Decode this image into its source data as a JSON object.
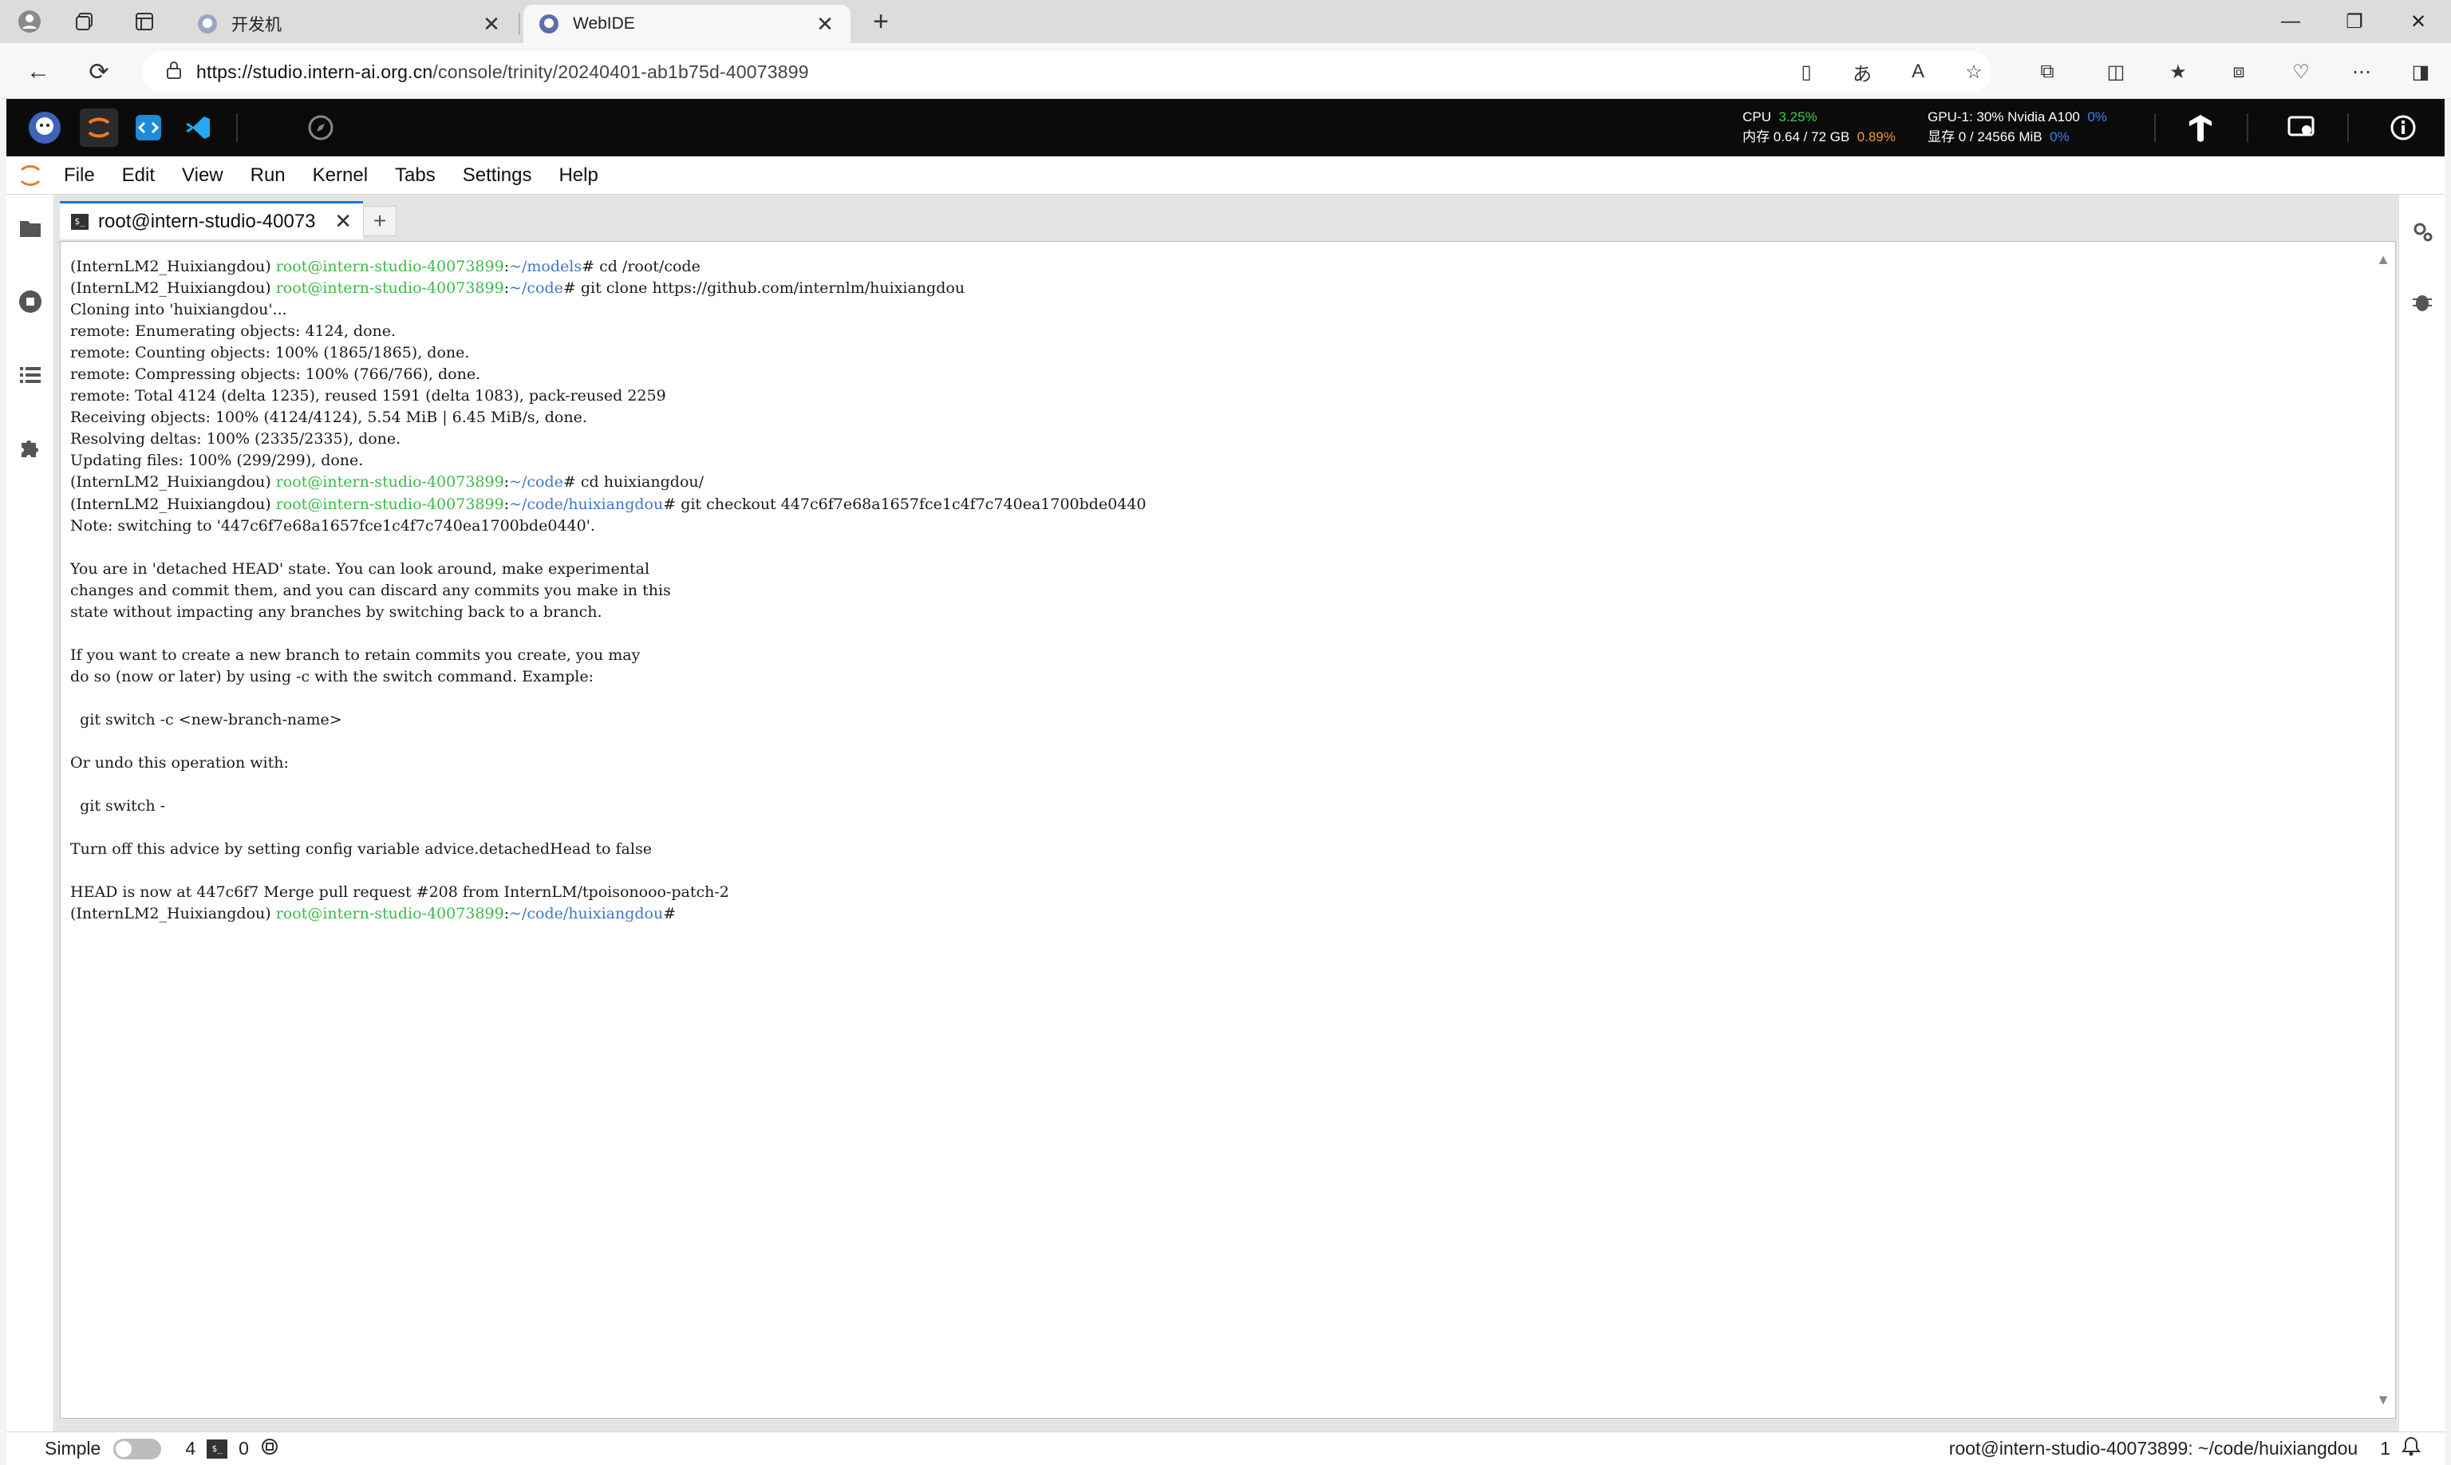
{
  "browser": {
    "tabs": [
      {
        "title": "开发机",
        "active": false
      },
      {
        "title": "WebIDE",
        "active": true
      }
    ],
    "url_host": "https://studio.intern-ai.org.cn",
    "url_path": "/console/trinity/20240401-ab1b75d-40073899"
  },
  "ide": {
    "stats": {
      "cpu_label": "CPU",
      "cpu_value": "3.25%",
      "mem_label": "内存",
      "mem_value": "0.64 / 72 GB",
      "mem_percent": "0.89%",
      "gpu_label": "GPU-1: 30% Nvidia A100",
      "gpu_percent": "0%",
      "vram_label": "显存",
      "vram_value": "0 / 24566 MiB",
      "vram_percent": "0%"
    },
    "menu": [
      "File",
      "Edit",
      "View",
      "Run",
      "Kernel",
      "Tabs",
      "Settings",
      "Help"
    ],
    "doc_tab_title": "root@intern-studio-40073",
    "term_icon_text": "$_"
  },
  "terminal": {
    "env": "(InternLM2_Huixiangdou)",
    "user_host": "root@intern-studio-40073899",
    "prompts": [
      {
        "path": "~/models",
        "cmd": "cd /root/code"
      },
      {
        "path": "~/code",
        "cmd": "git clone https://github.com/internlm/huixiangdou"
      },
      {
        "path": "~/code",
        "cmd": "cd huixiangdou/"
      },
      {
        "path": "~/code/huixiangdou",
        "cmd": "git checkout 447c6f7e68a1657fce1c4f7c740ea1700bde0440"
      },
      {
        "path": "~/code/huixiangdou",
        "cmd": ""
      }
    ],
    "clone_output": [
      "Cloning into 'huixiangdou'...",
      "remote: Enumerating objects: 4124, done.",
      "remote: Counting objects: 100% (1865/1865), done.",
      "remote: Compressing objects: 100% (766/766), done.",
      "remote: Total 4124 (delta 1235), reused 1591 (delta 1083), pack-reused 2259",
      "Receiving objects: 100% (4124/4124), 5.54 MiB | 6.45 MiB/s, done.",
      "Resolving deltas: 100% (2335/2335), done.",
      "Updating files: 100% (299/299), done."
    ],
    "checkout_output": [
      "Note: switching to '447c6f7e68a1657fce1c4f7c740ea1700bde0440'.",
      "",
      "You are in 'detached HEAD' state. You can look around, make experimental",
      "changes and commit them, and you can discard any commits you make in this",
      "state without impacting any branches by switching back to a branch.",
      "",
      "If you want to create a new branch to retain commits you create, you may",
      "do so (now or later) by using -c with the switch command. Example:",
      "",
      "  git switch -c <new-branch-name>",
      "",
      "Or undo this operation with:",
      "",
      "  git switch -",
      "",
      "Turn off this advice by setting config variable advice.detachedHead to false",
      "",
      "HEAD is now at 447c6f7 Merge pull request #208 from InternLM/tpoisonooo-patch-2"
    ]
  },
  "statusbar": {
    "mode_label": "Simple",
    "count_a": "4",
    "count_b": "0",
    "path": "root@intern-studio-40073899: ~/code/huixiangdou",
    "notifications": "1"
  },
  "colors": {
    "prompt_user": "#3cb94a",
    "prompt_path": "#3f76c6",
    "stat_green": "#3ecf4d",
    "stat_orange": "#f29a38",
    "stat_blue": "#3b82f6"
  }
}
